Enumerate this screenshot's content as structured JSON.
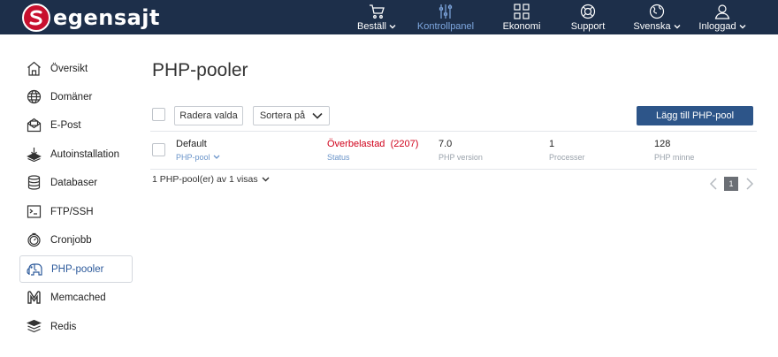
{
  "brand": {
    "name": "egensajt"
  },
  "nav": {
    "items": [
      {
        "label": "Beställ",
        "icon": "cart-icon",
        "dropdown": true
      },
      {
        "label": "Kontrollpanel",
        "icon": "sliders-icon",
        "active": true
      },
      {
        "label": "Ekonomi",
        "icon": "grid-icon"
      },
      {
        "label": "Support",
        "icon": "lifebuoy-icon"
      },
      {
        "label": "Svenska",
        "icon": "globe-icon",
        "dropdown": true
      },
      {
        "label": "Inloggad",
        "icon": "user-icon",
        "dropdown": true
      }
    ]
  },
  "sidebar": {
    "items": [
      {
        "label": "Översikt",
        "icon": "home-icon"
      },
      {
        "label": "Domäner",
        "icon": "globe-icon"
      },
      {
        "label": "E-Post",
        "icon": "mail-icon"
      },
      {
        "label": "Autoinstallation",
        "icon": "install-icon"
      },
      {
        "label": "Databaser",
        "icon": "database-icon"
      },
      {
        "label": "FTP/SSH",
        "icon": "terminal-icon"
      },
      {
        "label": "Cronjobb",
        "icon": "clock-icon"
      },
      {
        "label": "PHP-pooler",
        "icon": "elephant-icon",
        "active": true
      },
      {
        "label": "Memcached",
        "icon": "memcached-icon"
      },
      {
        "label": "Redis",
        "icon": "redis-icon"
      }
    ]
  },
  "main": {
    "title": "PHP-pooler",
    "toolbar": {
      "delete_label": "Radera valda",
      "sort_label": "Sortera på",
      "add_label": "Lägg till PHP-pool"
    },
    "row": {
      "name": "Default",
      "name_sub": "PHP-pool",
      "status": "Överbelastad",
      "status_count": "(2207)",
      "status_sub": "Status",
      "php_version": "7.0",
      "php_version_sub": "PHP version",
      "processes": "1",
      "processes_sub": "Processer",
      "memory": "128",
      "memory_sub": "PHP minne"
    },
    "footer": {
      "summary": "1 PHP-pool(er) av 1 visas",
      "page": "1"
    }
  },
  "colors": {
    "header": "#1d2f4a",
    "accent": "#2d5589",
    "status_red": "#d0021b",
    "link": "#6a94c9"
  }
}
